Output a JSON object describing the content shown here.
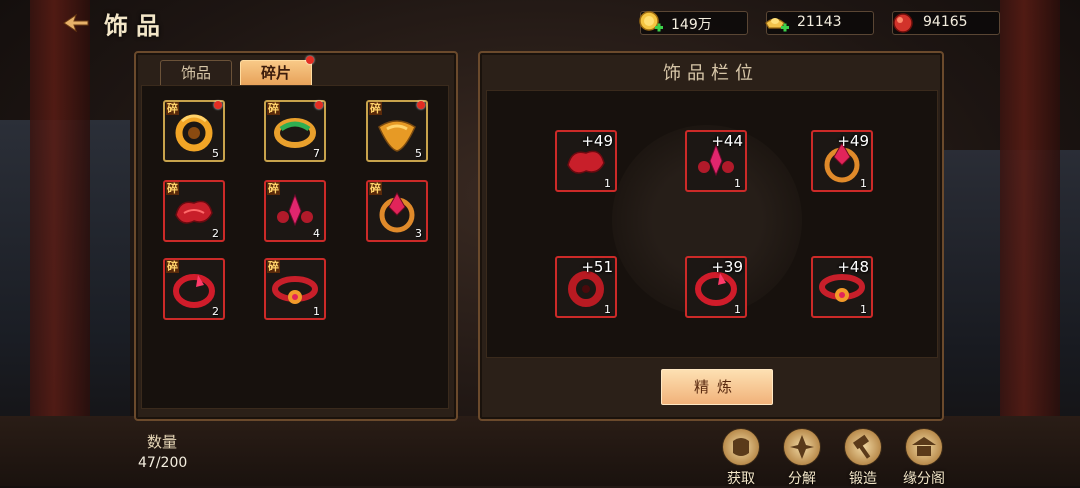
{
  "header": {
    "title": "饰品"
  },
  "resources": [
    {
      "value": "149万",
      "icon": "gold-coin-icon"
    },
    {
      "value": "21143",
      "icon": "gold-ingot-icon"
    },
    {
      "value": "94165",
      "icon": "red-gem-icon"
    }
  ],
  "tabs": [
    {
      "label": "饰品",
      "active": false
    },
    {
      "label": "碎片",
      "active": true
    }
  ],
  "fragments": [
    {
      "count": "5",
      "frame": "gold",
      "badge": "碎",
      "red_dot": true
    },
    {
      "count": "7",
      "frame": "gold",
      "badge": "碎",
      "red_dot": true
    },
    {
      "count": "5",
      "frame": "gold",
      "badge": "碎",
      "red_dot": true
    },
    {
      "count": "2",
      "frame": "red",
      "badge": "碎",
      "red_dot": false
    },
    {
      "count": "4",
      "frame": "red",
      "badge": "碎",
      "red_dot": false
    },
    {
      "count": "3",
      "frame": "red",
      "badge": "碎",
      "red_dot": false
    },
    {
      "count": "2",
      "frame": "red",
      "badge": "碎",
      "red_dot": false
    },
    {
      "count": "1",
      "frame": "red",
      "badge": "碎",
      "red_dot": false
    }
  ],
  "slots_panel": {
    "title": "饰品栏位"
  },
  "slots": [
    {
      "level": "+49",
      "count": "1"
    },
    {
      "level": "+44",
      "count": "1"
    },
    {
      "level": "+49",
      "count": "1"
    },
    {
      "level": "+51",
      "count": "1"
    },
    {
      "level": "+39",
      "count": "1"
    },
    {
      "level": "+48",
      "count": "1"
    }
  ],
  "refine_button": {
    "label": "精炼"
  },
  "inventory": {
    "label": "数量",
    "value": "47/200"
  },
  "actions": [
    {
      "label": "获取",
      "icon": "scroll-icon"
    },
    {
      "label": "分解",
      "icon": "decompose-icon"
    },
    {
      "label": "锻造",
      "icon": "hammer-icon"
    },
    {
      "label": "缘分阁",
      "icon": "pavilion-icon"
    }
  ],
  "colors": {
    "accent": "#e7a25a",
    "frame_gold": "#c8a34c",
    "frame_red": "#cc2a28"
  }
}
